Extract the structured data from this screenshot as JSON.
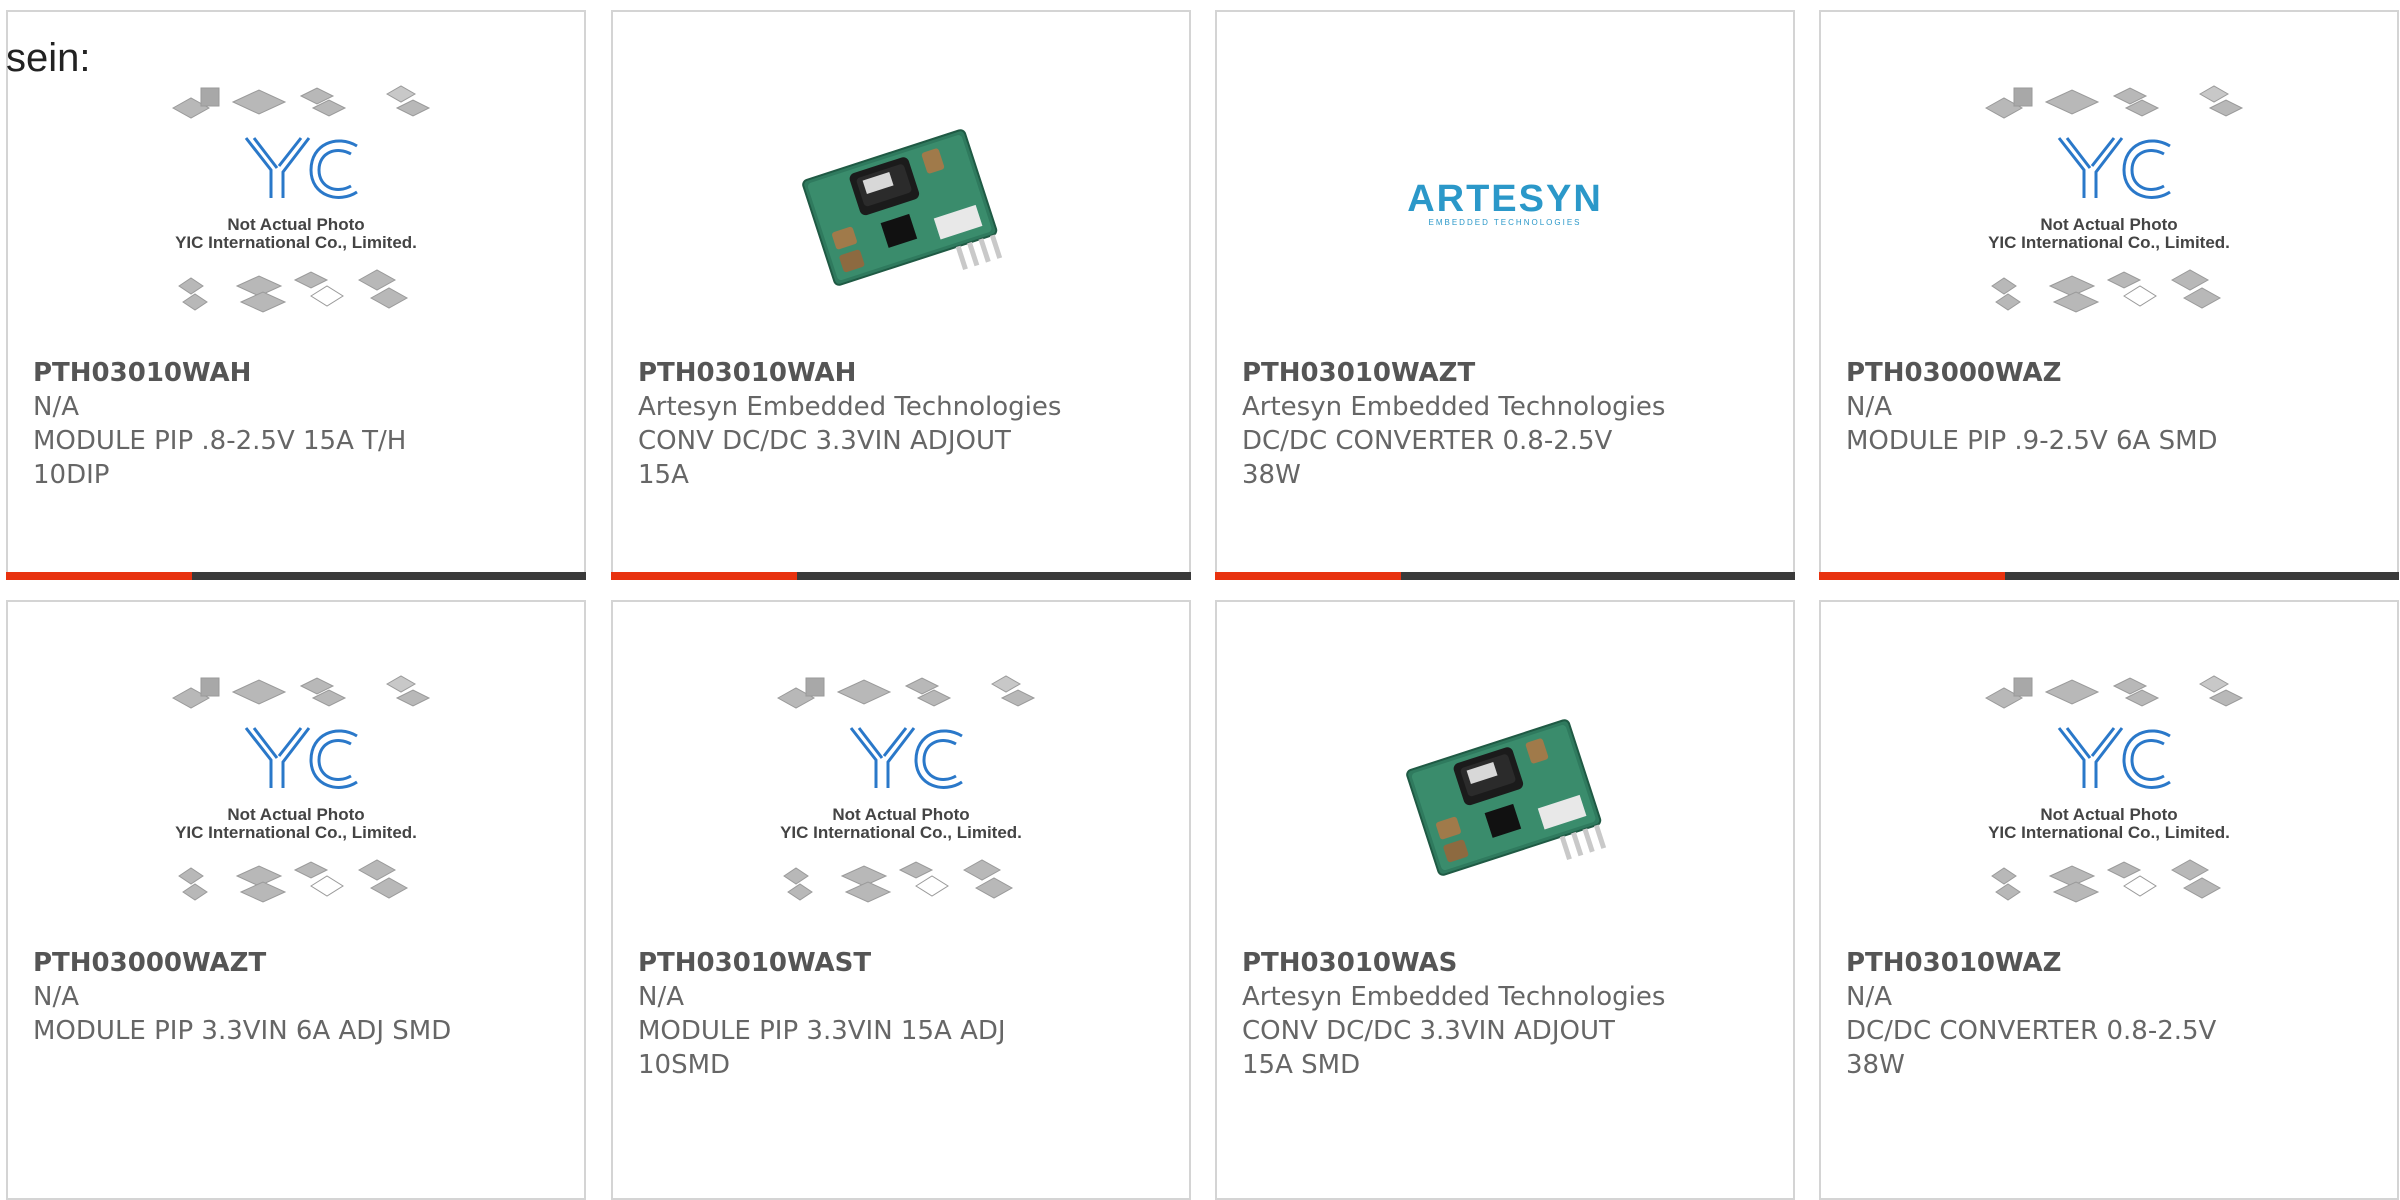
{
  "page": {
    "heading": "sein:"
  },
  "colors": {
    "accent": "#e8320f",
    "bar": "#3a3a3a",
    "border": "#d4d4d4",
    "yic_blue": "#2a78c9"
  },
  "placeholder": {
    "line1": "Not Actual Photo",
    "line2": "YIC International Co., Limited.",
    "logo_text": "YIC"
  },
  "artesyn": {
    "logo": "ARTESYN",
    "tagline": "EMBEDDED TECHNOLOGIES"
  },
  "products": [
    {
      "part": "PTH03010WAH",
      "maker": "N/A",
      "desc": "MODULE PIP .8-2.5V 15A T/H 10DIP",
      "image": "placeholder"
    },
    {
      "part": "PTH03010WAH",
      "maker": "Artesyn Embedded Technologies",
      "desc": "CONV DC/DC 3.3VIN ADJOUT 15A",
      "image": "module-photo"
    },
    {
      "part": "PTH03010WAZT",
      "maker": "Artesyn Embedded Technologies",
      "desc": "DC/DC CONVERTER 0.8-2.5V 38W",
      "image": "artesyn-logo"
    },
    {
      "part": "PTH03000WAZ",
      "maker": "N/A",
      "desc": "MODULE PIP .9-2.5V 6A SMD",
      "image": "placeholder"
    },
    {
      "part": "PTH03000WAZT",
      "maker": "N/A",
      "desc": "MODULE PIP 3.3VIN 6A ADJ SMD",
      "image": "placeholder"
    },
    {
      "part": "PTH03010WAST",
      "maker": "N/A",
      "desc": "MODULE PIP 3.3VIN 15A ADJ 10SMD",
      "image": "placeholder"
    },
    {
      "part": "PTH03010WAS",
      "maker": "Artesyn Embedded Technologies",
      "desc": "CONV DC/DC 3.3VIN ADJOUT 15A SMD",
      "image": "module-photo"
    },
    {
      "part": "PTH03010WAZ",
      "maker": "N/A",
      "desc": "DC/DC CONVERTER 0.8-2.5V 38W",
      "image": "placeholder"
    }
  ]
}
